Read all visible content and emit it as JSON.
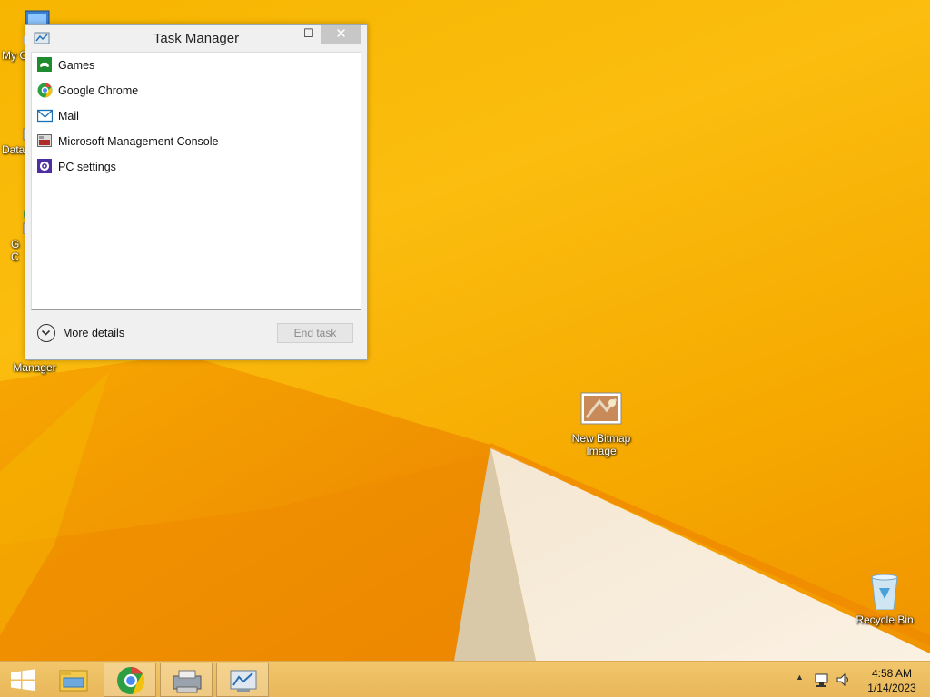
{
  "desktop": {
    "icons": [
      {
        "label": "My C",
        "icon": "computer-icon"
      },
      {
        "label": "Data",
        "icon": "shortcut-icon"
      },
      {
        "label": "G\nC",
        "icon": "chrome-shortcut-icon"
      },
      {
        "label": "In\nDo\nManager",
        "icon": "download-manager-icon"
      },
      {
        "label": "New Bitmap Image",
        "icon": "bitmap-image-icon"
      },
      {
        "label": "Recycle Bin",
        "icon": "recycle-bin-icon"
      }
    ]
  },
  "task_manager": {
    "title": "Task Manager",
    "minimize_glyph": "—",
    "maximize_glyph": "☐",
    "close_glyph": "✕",
    "apps": [
      {
        "label": "Games",
        "icon": "games-icon",
        "color": "#1e8c2e"
      },
      {
        "label": "Google Chrome",
        "icon": "chrome-icon",
        "color": "#db4437"
      },
      {
        "label": "Mail",
        "icon": "mail-icon",
        "color": "#1a6fb5"
      },
      {
        "label": "Microsoft Management Console",
        "icon": "mmc-icon",
        "color": "#b02a2a"
      },
      {
        "label": "PC settings",
        "icon": "settings-icon",
        "color": "#4b2fa3"
      }
    ],
    "more_details": "More details",
    "end_task": "End task"
  },
  "taskbar": {
    "start": "start-icon",
    "pinned": [
      "file-explorer-icon",
      "chrome-icon",
      "printer-icon",
      "task-manager-icon"
    ],
    "tray": {
      "show_hidden": "▲",
      "network": "network-icon",
      "volume": "volume-icon"
    },
    "clock_time": "4:58 AM",
    "clock_date": "1/14/2023"
  },
  "colors": {
    "wallpaper": "#f7b500",
    "taskbar": "#f0c060",
    "accent": "#f09300"
  }
}
